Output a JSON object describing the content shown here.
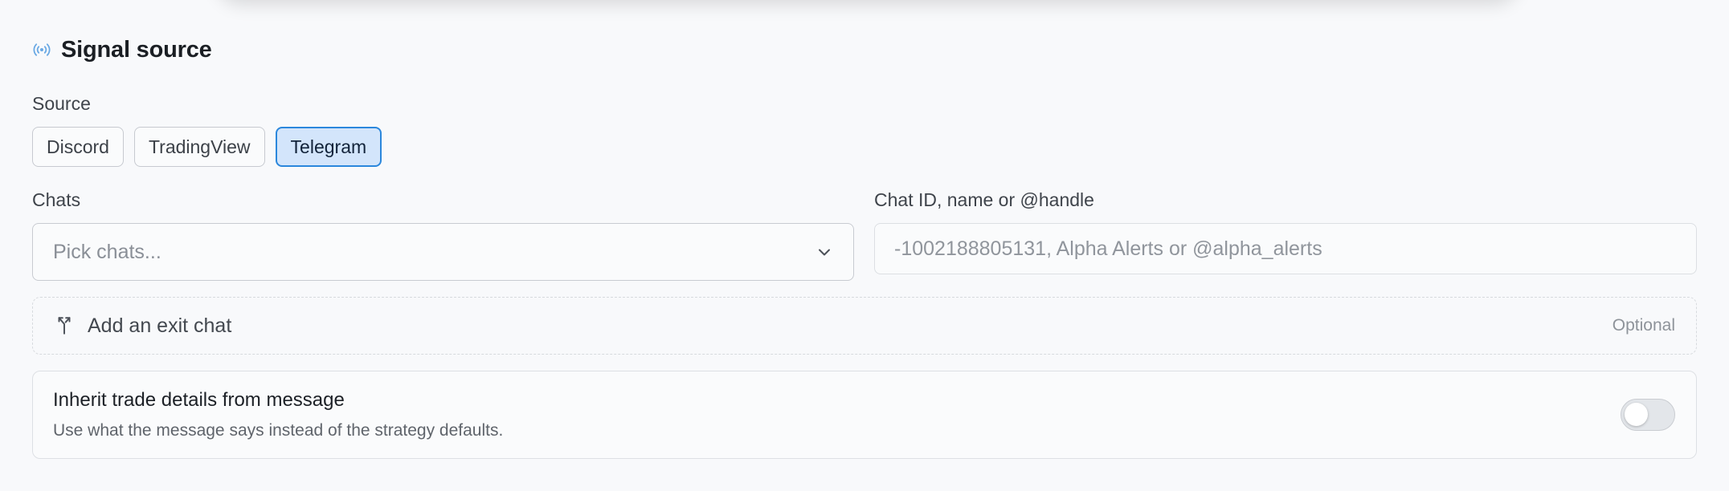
{
  "section": {
    "title": "Signal source",
    "icon": "broadcast-icon"
  },
  "source": {
    "label": "Source",
    "options": [
      "Discord",
      "TradingView",
      "Telegram"
    ],
    "selected": "Telegram"
  },
  "chats": {
    "label": "Chats",
    "placeholder": "Pick chats..."
  },
  "chat_id": {
    "label": "Chat ID, name or @handle",
    "placeholder": "-1002188805131, Alpha Alerts or @alpha_alerts",
    "value": ""
  },
  "exit_chat": {
    "label": "Add an exit chat",
    "optional": "Optional",
    "icon": "split-arrow-icon"
  },
  "inherit": {
    "title": "Inherit trade details from message",
    "description": "Use what the message says instead of the strategy defaults.",
    "enabled": false
  },
  "colors": {
    "accent": "#2b87dc",
    "accent_bg": "#d3e5fb",
    "icon_blue": "#6aa9e4"
  }
}
